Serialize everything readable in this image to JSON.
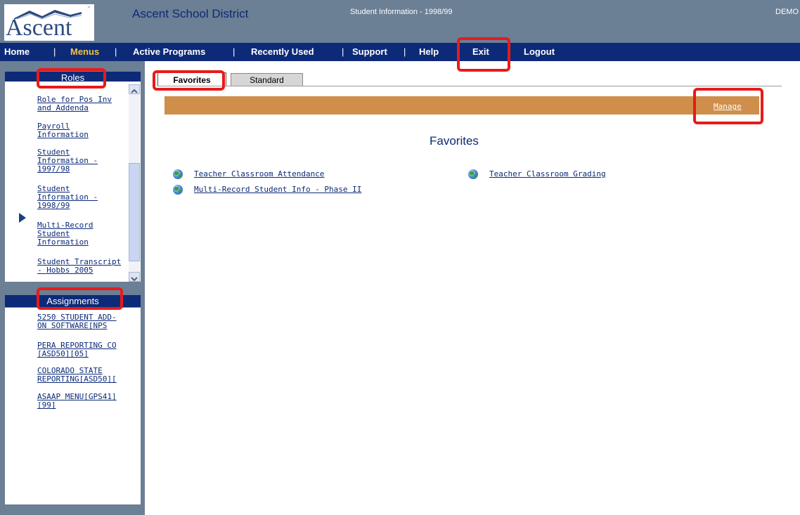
{
  "header": {
    "logo_text": "Ascent",
    "district_name": "Ascent School District",
    "current_role": "Student Information - 1998/99",
    "user": "DEMO"
  },
  "nav": {
    "home": "Home",
    "menus": "Menus",
    "active_programs": "Active Programs",
    "recently_used": "Recently Used",
    "support": "Support",
    "help": "Help",
    "exit": "Exit",
    "logout": "Logout",
    "separator": "|"
  },
  "roles": {
    "title": "Roles",
    "items": [
      {
        "label": "Role for Pos Inv\nand Addenda"
      },
      {
        "label": "Payroll\nInformation"
      },
      {
        "label": "Student\nInformation -\n1997/98"
      },
      {
        "label": "Student\nInformation -\n1998/99"
      },
      {
        "label": "Multi-Record\nStudent\nInformation"
      },
      {
        "label": "Student Transcript\n- Hobbs 2005"
      }
    ]
  },
  "assignments": {
    "title": "Assignments",
    "items": [
      {
        "label": "5250 STUDENT ADD-\nON SOFTWARE[NPS"
      },
      {
        "label": "PERA REPORTING CO\n[ASD50][05]"
      },
      {
        "label": "COLORADO STATE\nREPORTING[ASD50]["
      },
      {
        "label": "ASAAP MENU[GPS41]\n[99]"
      }
    ]
  },
  "tabs": {
    "favorites": "Favorites",
    "standard": "Standard"
  },
  "toolbar": {
    "manage": "Manage"
  },
  "main": {
    "title": "Favorites",
    "favorites": [
      {
        "label": "Teacher Classroom Attendance"
      },
      {
        "label": "Teacher Classroom Grading"
      },
      {
        "label": "Multi-Record Student Info - Phase II"
      }
    ]
  },
  "colors": {
    "header_bg": "#6b7f95",
    "nav_bg": "#0c2a78",
    "nav_active": "#f3c540",
    "tan_bar": "#cf8f4b",
    "highlight": "#e81a1a"
  }
}
